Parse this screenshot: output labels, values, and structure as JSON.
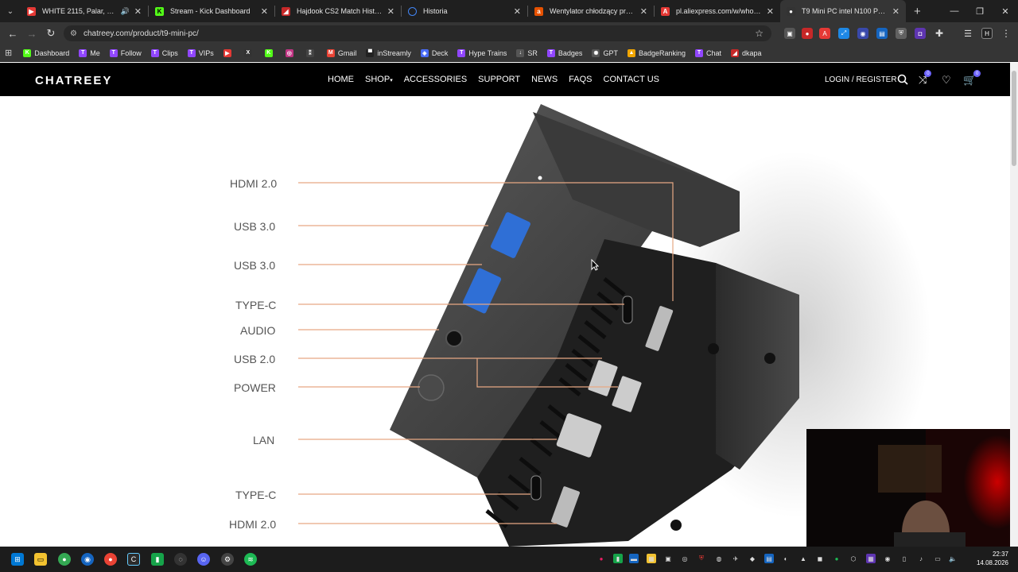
{
  "browser": {
    "tabs": [
      {
        "title": "WHITE 2115, Palar, Kizo - R",
        "icon_color": "#e53935",
        "has_audio": true
      },
      {
        "title": "Stream - Kick Dashboard",
        "icon_color": "#53fc18"
      },
      {
        "title": "Hajdook CS2 Match History - F",
        "icon_color": "#c62828"
      },
      {
        "title": "Historia",
        "icon_color": "#4285f4"
      },
      {
        "title": "Wentylator chłodzący procesor",
        "icon_color": "#e65100"
      },
      {
        "title": "pl.aliexpress.com/w/wholesale-",
        "icon_color": "#e53935"
      },
      {
        "title": "T9 Mini PC intel N100 Pocket S",
        "icon_color": "#333333",
        "active": true
      }
    ],
    "url": "chatreey.com/product/t9-mini-pc/",
    "bookmarks": [
      {
        "label": "Dashboard",
        "color": "#53fc18",
        "glyph": "K"
      },
      {
        "label": "Me",
        "color": "#9146ff",
        "glyph": "T"
      },
      {
        "label": "Follow",
        "color": "#9146ff",
        "glyph": "T"
      },
      {
        "label": "Clips",
        "color": "#9146ff",
        "glyph": "T"
      },
      {
        "label": "VIPs",
        "color": "#9146ff",
        "glyph": "T"
      },
      {
        "label": "",
        "color": "#e53935",
        "glyph": "▶"
      },
      {
        "label": "",
        "color": "#333333",
        "glyph": "X"
      },
      {
        "label": "",
        "color": "#53fc18",
        "glyph": "K"
      },
      {
        "label": "",
        "color": "#c13584",
        "glyph": "◎"
      },
      {
        "label": "",
        "color": "#444444",
        "glyph": "⁑"
      },
      {
        "label": "Gmail",
        "color": "#ea4335",
        "glyph": "M"
      },
      {
        "label": "inStreamly",
        "color": "#222222",
        "glyph": "▀"
      },
      {
        "label": "Deck",
        "color": "#4a6cf7",
        "glyph": "◈"
      },
      {
        "label": "Hype Trains",
        "color": "#9146ff",
        "glyph": "T"
      },
      {
        "label": "SR",
        "color": "#555555",
        "glyph": "↓"
      },
      {
        "label": "Badges",
        "color": "#9146ff",
        "glyph": "T"
      },
      {
        "label": "GPT",
        "color": "#555555",
        "glyph": "✺"
      },
      {
        "label": "BadgeRanking",
        "color": "#f0a500",
        "glyph": "▲"
      },
      {
        "label": "Chat",
        "color": "#9146ff",
        "glyph": "T"
      },
      {
        "label": "dkapa",
        "color": "#c62828",
        "glyph": "◢"
      }
    ]
  },
  "site": {
    "logo": "CHATREEY",
    "menu": [
      "HOME",
      "SHOP",
      "ACCESSORIES",
      "SUPPORT",
      "NEWS",
      "FAQS",
      "CONTACT US"
    ],
    "shop_caret": "▾",
    "login": "LOGIN / REGISTER",
    "compare_count": "0",
    "cart_count": "0"
  },
  "diagram": {
    "ports": [
      "HDMI 2.0",
      "USB 3.0",
      "USB 3.0",
      "TYPE-C",
      "AUDIO",
      "USB 2.0",
      "POWER",
      "LAN",
      "TYPE-C",
      "HDMI 2.0"
    ],
    "accent": "#e7a883"
  },
  "taskbar": {
    "time": "22:37",
    "date": "14.08.2026"
  }
}
